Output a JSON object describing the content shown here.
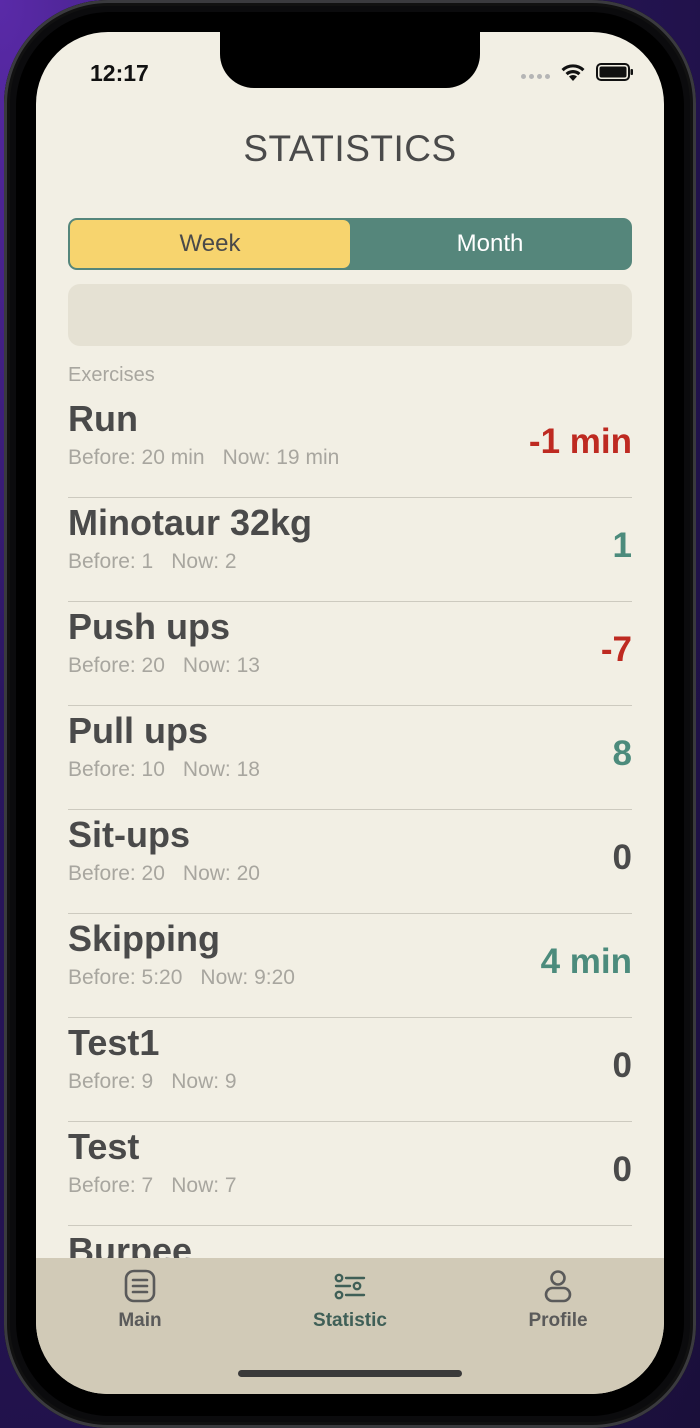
{
  "status": {
    "time": "12:17"
  },
  "header": {
    "title": "STATISTICS"
  },
  "segment": {
    "week": "Week",
    "month": "Month",
    "selected": "Week"
  },
  "section_label": "Exercises",
  "exercises": [
    {
      "name": "Run",
      "before": "Before: 20 min",
      "now": "Now: 19 min",
      "delta": "-1 min",
      "trend": "neg"
    },
    {
      "name": "Minotaur 32kg",
      "before": "Before: 1",
      "now": "Now: 2",
      "delta": "1",
      "trend": "pos"
    },
    {
      "name": "Push ups",
      "before": "Before: 20",
      "now": "Now: 13",
      "delta": "-7",
      "trend": "neg"
    },
    {
      "name": "Pull ups",
      "before": "Before: 10",
      "now": "Now: 18",
      "delta": "8",
      "trend": "pos"
    },
    {
      "name": "Sit-ups",
      "before": "Before: 20",
      "now": "Now: 20",
      "delta": "0",
      "trend": "zero"
    },
    {
      "name": "Skipping",
      "before": "Before: 5:20",
      "now": "Now: 9:20",
      "delta": "4 min",
      "trend": "pos"
    },
    {
      "name": "Test1",
      "before": "Before: 9",
      "now": "Now: 9",
      "delta": "0",
      "trend": "zero"
    },
    {
      "name": "Test",
      "before": "Before: 7",
      "now": "Now: 7",
      "delta": "0",
      "trend": "zero"
    },
    {
      "name": "Burpee",
      "before": "",
      "now": "",
      "delta": "",
      "trend": "zero"
    }
  ],
  "tabbar": {
    "main": "Main",
    "statistic": "Statistic",
    "profile": "Profile"
  },
  "icons": {
    "main": "list-icon",
    "statistic": "sliders-icon",
    "profile": "person-icon"
  },
  "colors": {
    "accent_green": "#55867b",
    "accent_yellow": "#f7d46e",
    "negative": "#be2a21",
    "positive": "#4c8b7c"
  }
}
